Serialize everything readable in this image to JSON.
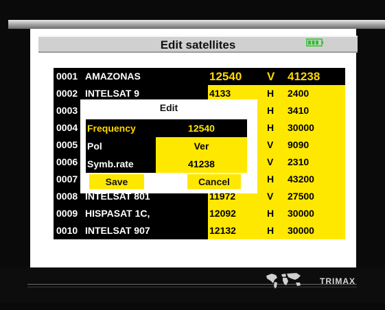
{
  "header": {
    "title": "Edit satellites",
    "battery_icon": "battery-icon",
    "accent": "#ffe800"
  },
  "rows": [
    {
      "num": "0001",
      "name": "AMAZONAS",
      "freq": "12540",
      "pol": "V",
      "sym": "41238"
    },
    {
      "num": "0002",
      "name": "INTELSAT 9",
      "freq": "4133",
      "pol": "H",
      "sym": "2400"
    },
    {
      "num": "0003",
      "name": "",
      "freq": "",
      "pol": "H",
      "sym": "3410"
    },
    {
      "num": "0004",
      "name": "",
      "freq": "",
      "pol": "H",
      "sym": "30000"
    },
    {
      "num": "0005",
      "name": "",
      "freq": "",
      "pol": "V",
      "sym": "9090"
    },
    {
      "num": "0006",
      "name": "",
      "freq": "",
      "pol": "V",
      "sym": "2310"
    },
    {
      "num": "0007",
      "name": "",
      "freq": "",
      "pol": "H",
      "sym": "43200"
    },
    {
      "num": "0008",
      "name": "INTELSAT 801",
      "freq": "11972",
      "pol": "V",
      "sym": "27500"
    },
    {
      "num": "0009",
      "name": "HISPASAT 1C,",
      "freq": "12092",
      "pol": "H",
      "sym": "30000"
    },
    {
      "num": "0010",
      "name": "INTELSAT 907",
      "freq": "12132",
      "pol": "H",
      "sym": "30000"
    }
  ],
  "dialog": {
    "title": "Edit",
    "fields": [
      {
        "label": "Frequency",
        "value": "12540"
      },
      {
        "label": "Pol",
        "value": "Ver"
      },
      {
        "label": "Symb.rate",
        "value": "41238"
      }
    ],
    "save_label": "Save",
    "cancel_label": "Cancel"
  },
  "footer": {
    "brand": "TRIMAX",
    "map_icon": "world-map-icon"
  }
}
